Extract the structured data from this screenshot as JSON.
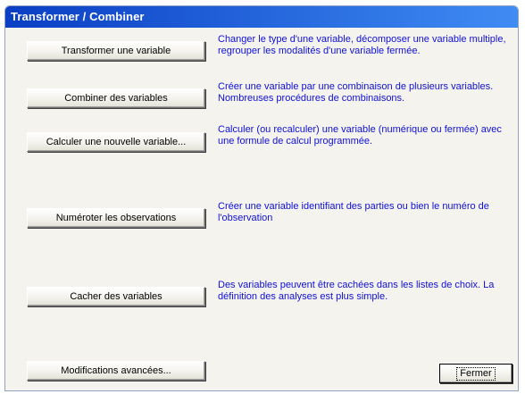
{
  "window": {
    "title": "Transformer / Combiner"
  },
  "actions": [
    {
      "label": "Transformer une variable",
      "description": "Changer le type d'une variable, décomposer une variable multiple, regrouper les modalités d'une variable fermée."
    },
    {
      "label": "Combiner des variables",
      "description": "Créer une variable par une combinaison de plusieurs variables. Nombreuses procédures de combinaisons."
    },
    {
      "label": "Calculer une nouvelle variable...",
      "description": "Calculer (ou recalculer) une variable (numérique ou fermée) avec une formule de calcul programmée."
    },
    {
      "label": "Numéroter les observations",
      "description": "Créer une variable identifiant des parties ou bien le numéro de l'observation"
    },
    {
      "label": "Cacher des variables",
      "description": "Des variables peuvent être cachées dans les listes de choix. La définition des analyses est plus simple."
    }
  ],
  "footer": {
    "advanced_label": "Modifications avancées...",
    "close_label": "Fermer"
  },
  "colors": {
    "description_text": "#1010d8",
    "titlebar_start": "#0a3ec4",
    "titlebar_end": "#3f8cf3",
    "dialog_background": "#f4f3ee"
  }
}
